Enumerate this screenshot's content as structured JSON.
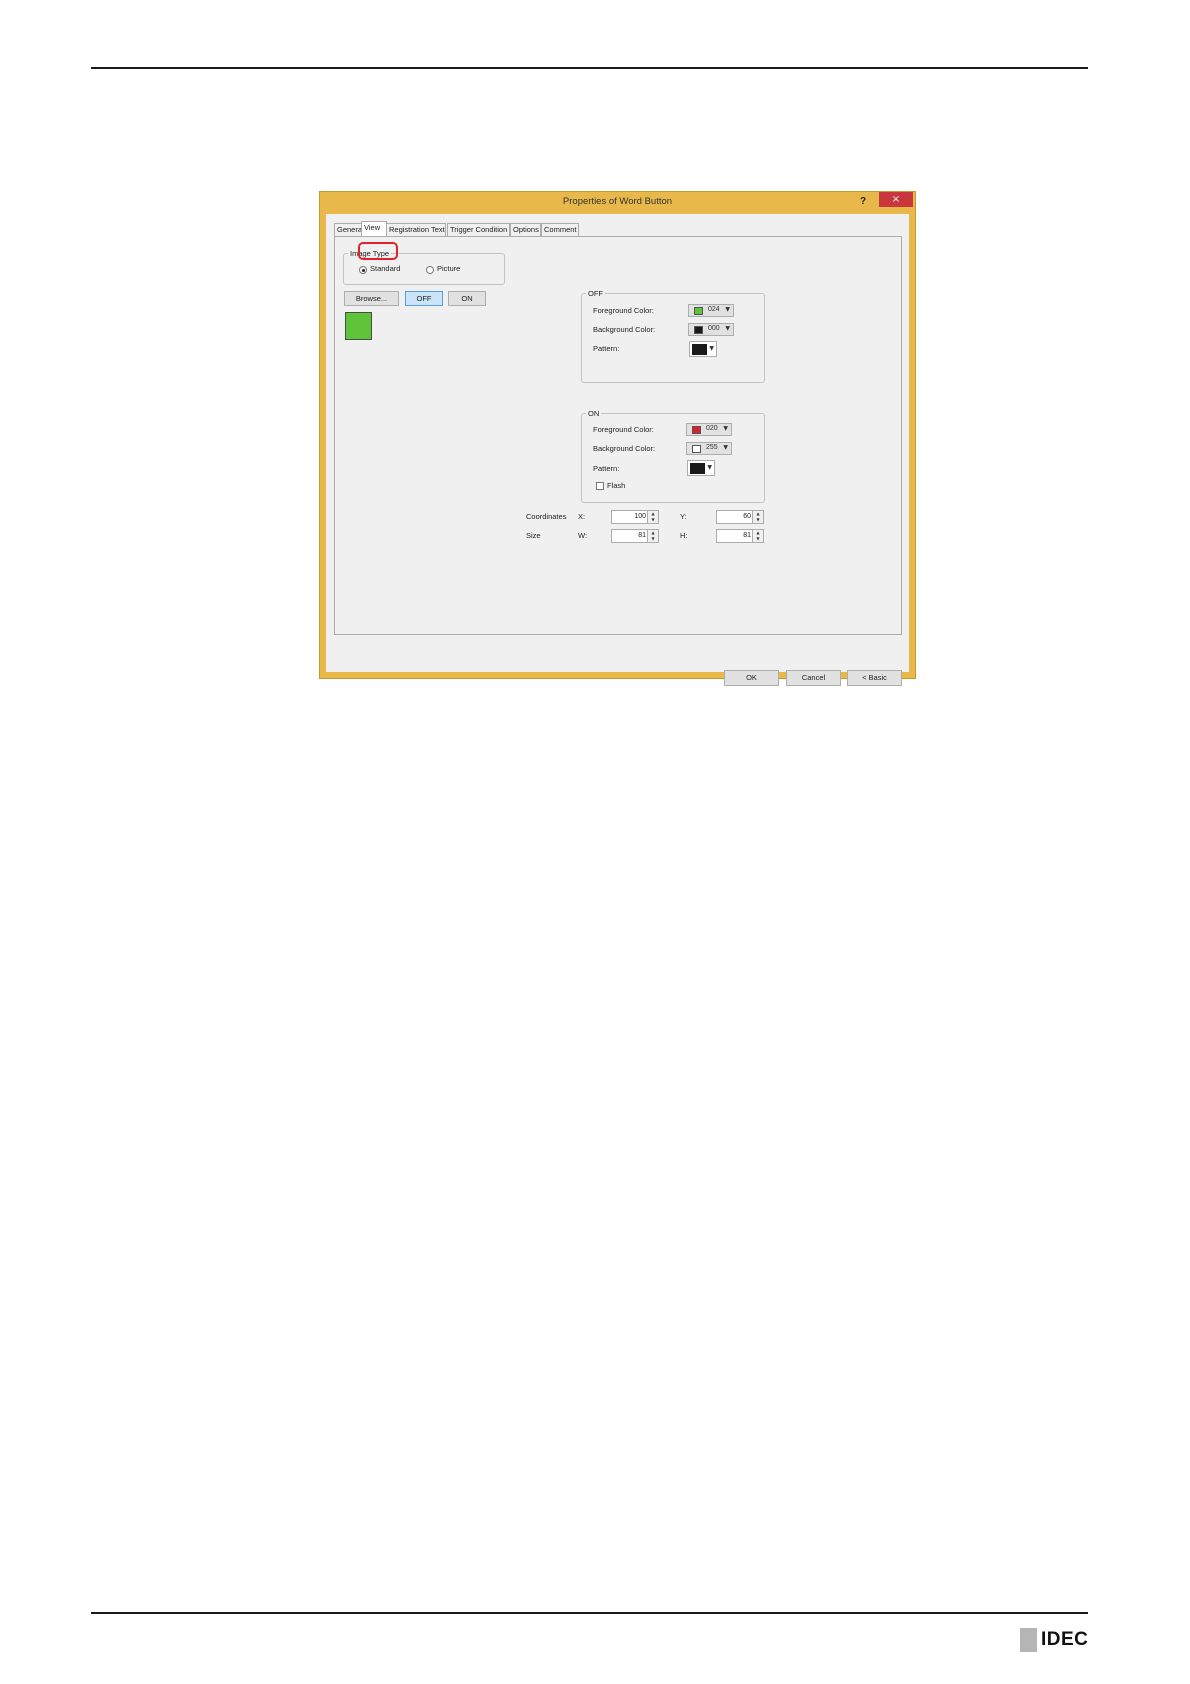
{
  "dialog": {
    "title": "Properties of Word Button",
    "help": "?",
    "close": "×",
    "tabs": [
      "General",
      "View",
      "Registration Text",
      "Trigger Condition",
      "Options",
      "Comment"
    ],
    "image_type": {
      "group_title": "Image Type",
      "standard": "Standard",
      "picture": "Picture",
      "selected": "Standard"
    },
    "buttons": {
      "browse": "Browse...",
      "off": "OFF",
      "on": "ON"
    },
    "preview_color": "#5fc43a",
    "off_group": {
      "title": "OFF",
      "foreground_label": "Foreground Color:",
      "foreground_value": "024",
      "foreground_color": "#5fc43a",
      "background_label": "Background Color:",
      "background_value": "000",
      "background_color": "#1a1a1a",
      "pattern_label": "Pattern:"
    },
    "on_group": {
      "title": "ON",
      "foreground_label": "Foreground Color:",
      "foreground_value": "020",
      "foreground_color": "#d8242a",
      "background_label": "Background Color:",
      "background_value": "255",
      "background_color": "#ffffff",
      "pattern_label": "Pattern:",
      "flash_label": "Flash"
    },
    "coordinates": {
      "label": "Coordinates",
      "x_label": "X:",
      "x_value": "100",
      "y_label": "Y:",
      "y_value": "60"
    },
    "size": {
      "label": "Size",
      "w_label": "W:",
      "w_value": "81",
      "h_label": "H:",
      "h_value": "81"
    },
    "footer": {
      "ok": "OK",
      "cancel": "Cancel",
      "basic": "< Basic"
    }
  },
  "logo": "IDEC"
}
